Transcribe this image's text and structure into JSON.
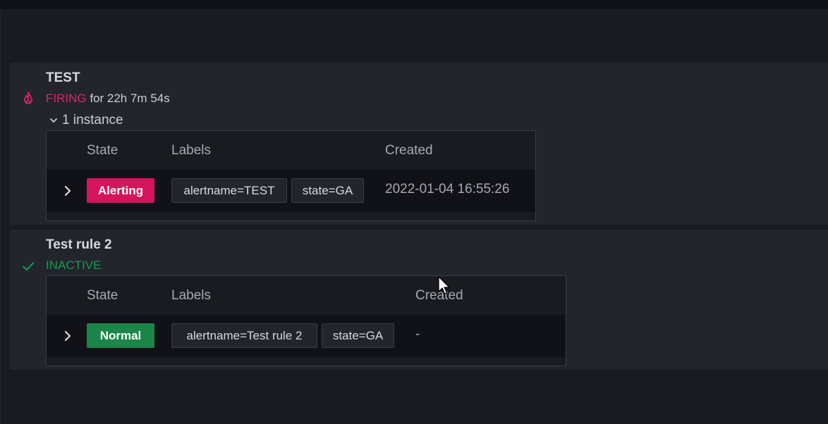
{
  "rules": [
    {
      "title": "TEST",
      "status_word": "FIRING",
      "status_suffix": " for 22h 7m 54s",
      "instances_toggle": "1 instance",
      "columns": [
        "State",
        "Labels",
        "Created"
      ],
      "instance": {
        "state": "Alerting",
        "labels": [
          "alertname=TEST",
          "state=GA"
        ],
        "created": "2022-01-04 16:55:26"
      }
    },
    {
      "title": "Test rule 2",
      "status_word": "INACTIVE",
      "columns": [
        "State",
        "Labels",
        "Created"
      ],
      "instance": {
        "state": "Normal",
        "labels": [
          "alertname=Test rule 2",
          "state=GA"
        ],
        "created": "-"
      }
    }
  ],
  "colors": {
    "firing": "#e0226e",
    "alerting_badge": "#d4155c",
    "inactive": "#1a9b52",
    "normal_badge": "#1b854a"
  },
  "icons": {
    "firing": "fire-icon",
    "inactive": "check-icon",
    "expand": "chevron-right-icon",
    "toggle": "chevron-down-icon"
  }
}
